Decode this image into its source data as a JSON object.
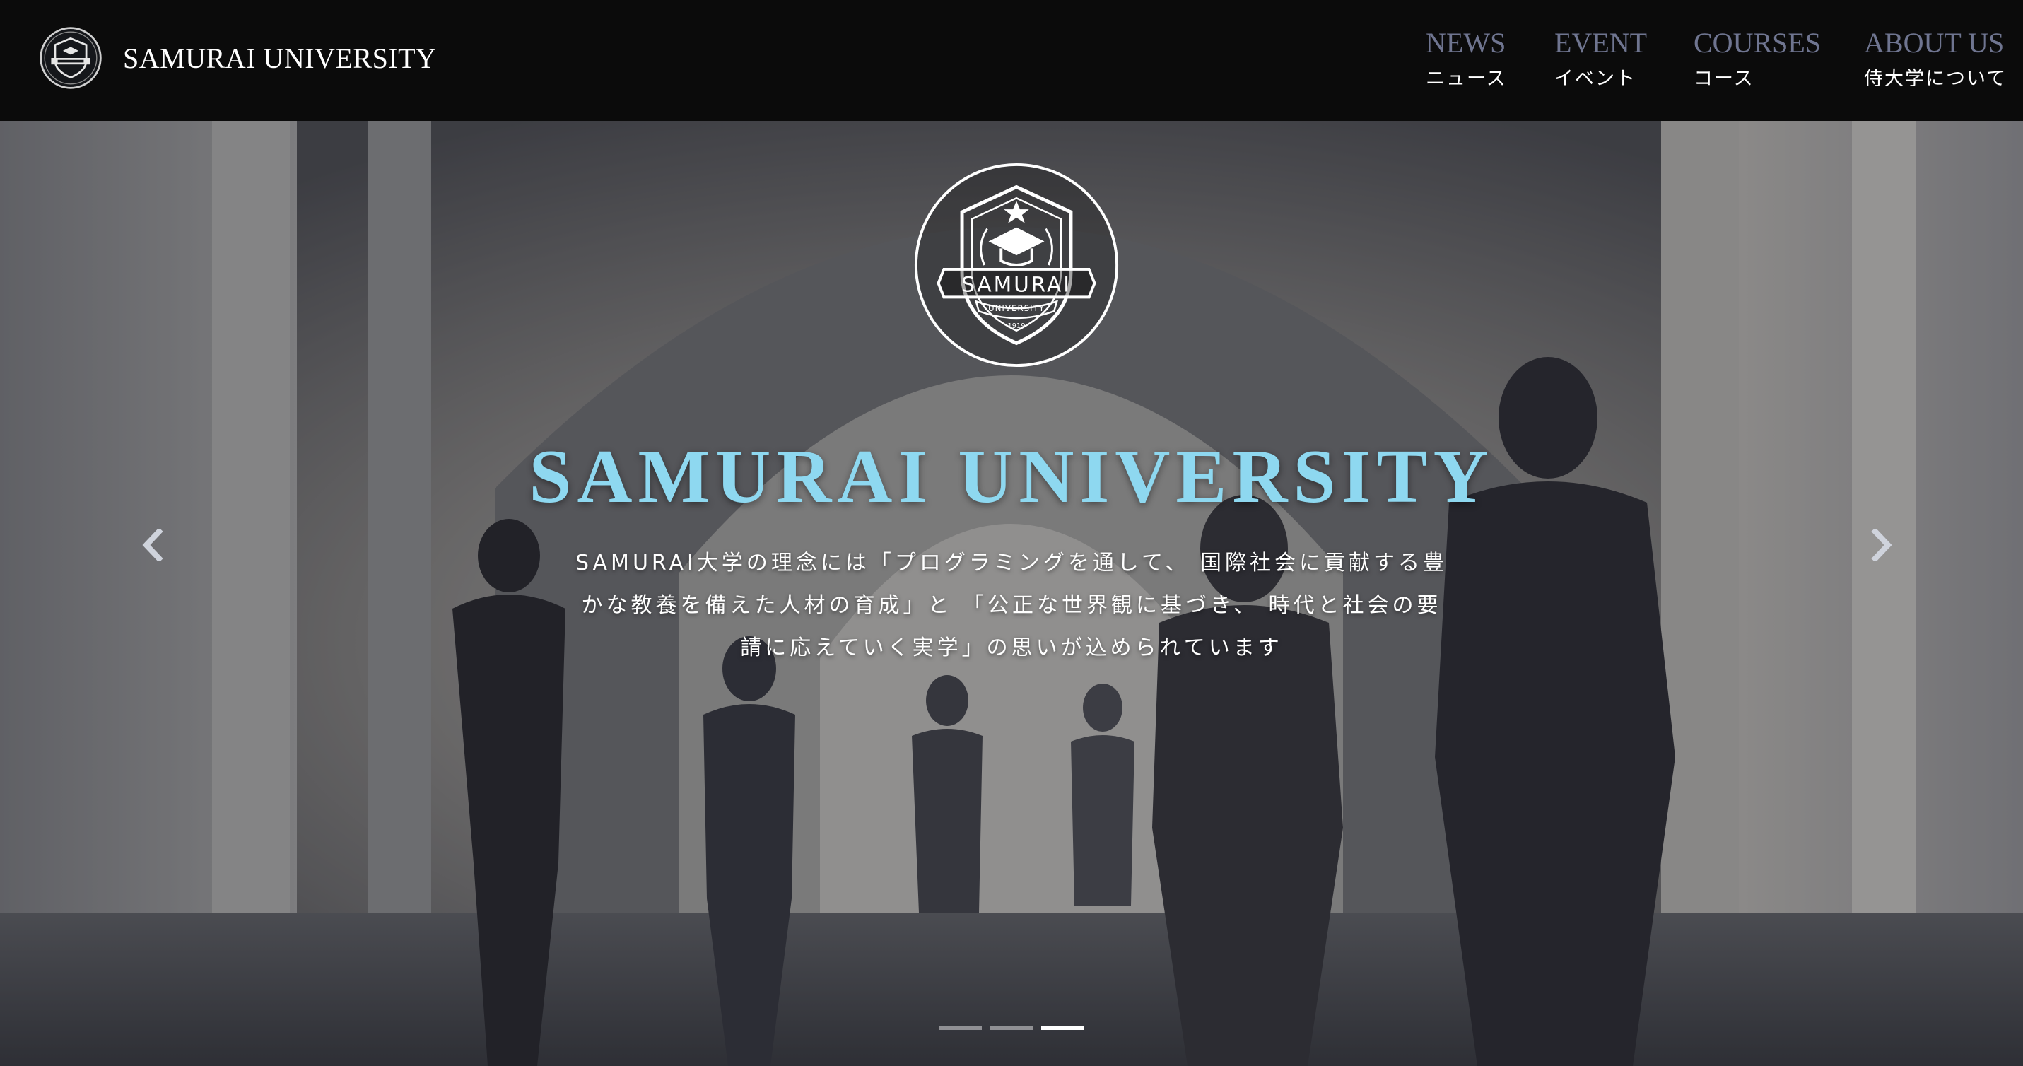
{
  "header": {
    "brand_name": "SAMURAI UNIVERSITY",
    "nav": [
      {
        "label_en": "NEWS",
        "label_ja": "ニュース"
      },
      {
        "label_en": "EVENT",
        "label_ja": "イベント"
      },
      {
        "label_en": "COURSES",
        "label_ja": "コース"
      },
      {
        "label_en": "ABOUT US",
        "label_ja": "侍大学について"
      }
    ]
  },
  "hero": {
    "emblem": {
      "banner_text": "SAMURAI",
      "ribbon_text": "UNIVERSITY",
      "year": "1919"
    },
    "title": "SAMURAI UNIVERSITY",
    "description_lines": [
      "SAMURAI大学の理念には「プログラミングを通して、 国際社会に貢献する豊",
      "かな教養を備えた人材の育成」と 「公正な世界観に基づき、 時代と社会の要",
      "請に応えていく実学」の思いが込められています"
    ],
    "carousel": {
      "slide_count": 3,
      "active_index": 2
    }
  },
  "colors": {
    "header_bg": "#0b0b0b",
    "nav_en": "#6f7590",
    "nav_ja": "#ffffff",
    "hero_title": "#8ed8f0",
    "hero_text": "#ffffff"
  },
  "icons": {
    "brand_logo": "university-crest-icon",
    "prev": "chevron-left-icon",
    "next": "chevron-right-icon"
  }
}
